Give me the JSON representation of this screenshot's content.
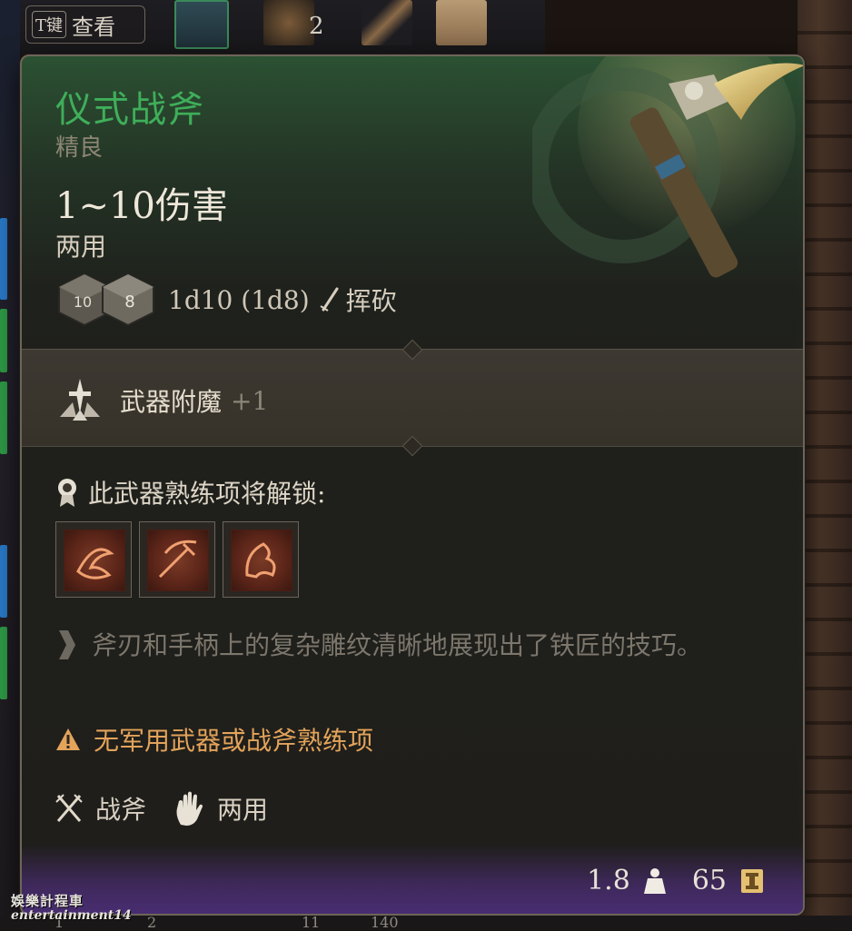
{
  "hotbar": {
    "key_cap": "T键",
    "key_label": "查看",
    "stack_count": "2"
  },
  "tooltip": {
    "name": "仪式战斧",
    "rarity": "精良",
    "damage": "1~10伤害",
    "handedness": "两用",
    "dice_roll": "1d10 (1d8)",
    "damage_type": "挥砍",
    "enchant_label": "武器附魔",
    "enchant_value": "+1",
    "proficiency_title": "此武器熟练项将解锁:",
    "skills": [
      {
        "icon": "weapon-action-icon-1"
      },
      {
        "icon": "weapon-action-icon-2"
      },
      {
        "icon": "weapon-action-icon-3"
      }
    ],
    "description": "斧刃和手柄上的复杂雕纹清晰地展现出了铁匠的技巧。",
    "warning": "无军用武器或战斧熟练项",
    "properties": [
      {
        "icon": "crossed-swords-icon",
        "label": "战斧"
      },
      {
        "icon": "hand-icon",
        "label": "两用"
      }
    ],
    "weight": "1.8",
    "price": "65",
    "colors": {
      "name": "#3fae5a",
      "warning": "#e3a35a",
      "footer": "#502e82"
    }
  },
  "watermark": {
    "cn": "娛樂計程車",
    "en": "entertainment14"
  },
  "bottom_strip": [
    "1",
    "2",
    "11",
    "140"
  ]
}
